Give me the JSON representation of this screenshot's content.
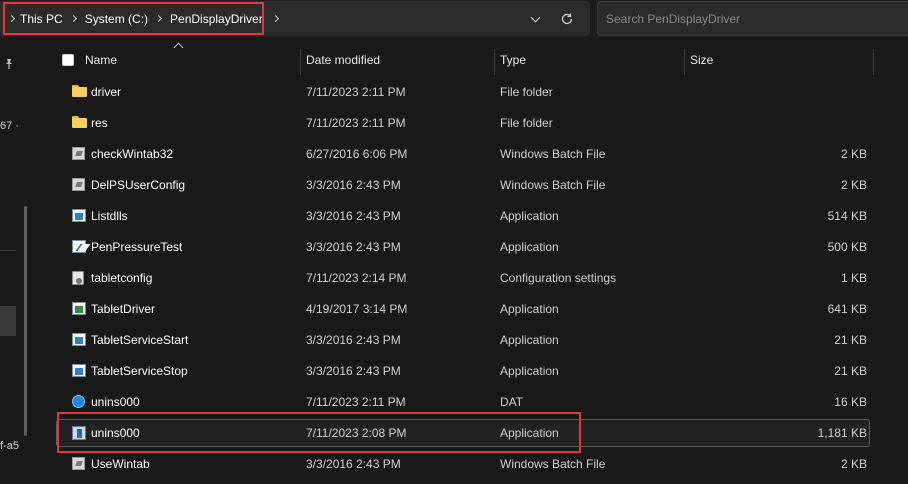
{
  "breadcrumb": {
    "items": [
      "This PC",
      "System (C:)",
      "PenDisplayDriver"
    ]
  },
  "search": {
    "placeholder": "Search PenDisplayDriver"
  },
  "nav": {
    "fragments": [
      "67 ·",
      "f-a5"
    ]
  },
  "columns": {
    "name": "Name",
    "date": "Date modified",
    "type": "Type",
    "size": "Size"
  },
  "files": [
    {
      "name": "driver",
      "date": "7/11/2023 2:11 PM",
      "type": "File folder",
      "size": "",
      "icon": "folder-icon"
    },
    {
      "name": "res",
      "date": "7/11/2023 2:11 PM",
      "type": "File folder",
      "size": "",
      "icon": "folder-icon"
    },
    {
      "name": "checkWintab32",
      "date": "6/27/2016 6:06 PM",
      "type": "Windows Batch File",
      "size": "2 KB",
      "icon": "batch-file-icon"
    },
    {
      "name": "DelPSUserConfig",
      "date": "3/3/2016 2:43 PM",
      "type": "Windows Batch File",
      "size": "2 KB",
      "icon": "batch-file-icon"
    },
    {
      "name": "Listdlls",
      "date": "3/3/2016 2:43 PM",
      "type": "Application",
      "size": "514 KB",
      "icon": "application-icon"
    },
    {
      "name": "PenPressureTest",
      "date": "3/3/2016 2:43 PM",
      "type": "Application",
      "size": "500 KB",
      "icon": "pen-application-icon"
    },
    {
      "name": "tabletconfig",
      "date": "7/11/2023 2:14 PM",
      "type": "Configuration settings",
      "size": "1 KB",
      "icon": "config-file-icon"
    },
    {
      "name": "TabletDriver",
      "date": "4/19/2017 3:14 PM",
      "type": "Application",
      "size": "641 KB",
      "icon": "tablet-application-icon"
    },
    {
      "name": "TabletServiceStart",
      "date": "3/3/2016 2:43 PM",
      "type": "Application",
      "size": "21 KB",
      "icon": "application-icon"
    },
    {
      "name": "TabletServiceStop",
      "date": "3/3/2016 2:43 PM",
      "type": "Application",
      "size": "21 KB",
      "icon": "application-icon"
    },
    {
      "name": "unins000",
      "date": "7/11/2023 2:11 PM",
      "type": "DAT",
      "size": "16 KB",
      "icon": "dat-file-icon"
    },
    {
      "name": "unins000",
      "date": "7/11/2023 2:08 PM",
      "type": "Application",
      "size": "1,181 KB",
      "icon": "uninstaller-icon",
      "selected": true
    },
    {
      "name": "UseWintab",
      "date": "3/3/2016 2:43 PM",
      "type": "Windows Batch File",
      "size": "2 KB",
      "icon": "batch-file-icon"
    }
  ],
  "colors": {
    "background": "#191919",
    "highlight": "#e0393e",
    "folder": "#f7cf5a"
  }
}
